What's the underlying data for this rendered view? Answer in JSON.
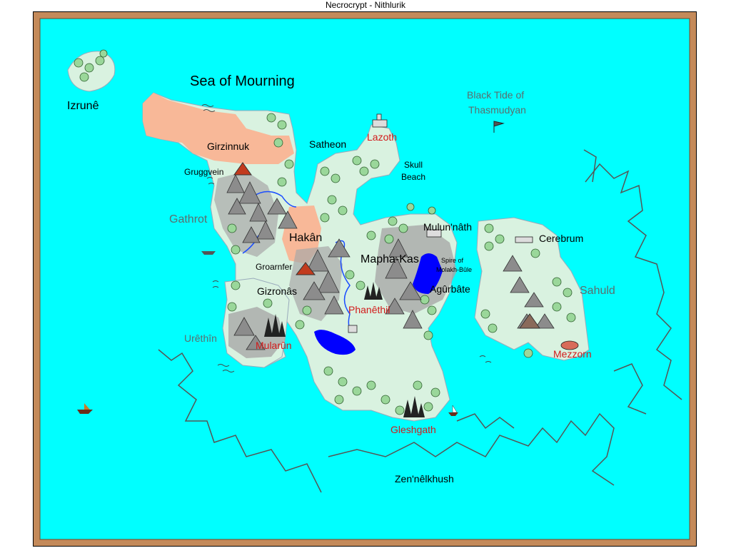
{
  "window": {
    "title": "Necrocrypt - Nithlurik"
  },
  "colors": {
    "sea": "#00ffff",
    "land": "#d9f2e0",
    "desert": "#f8b898",
    "mountain_shade": "#a8a8a8",
    "lake": "#0000ff",
    "frame": "#c48a5a",
    "red_label": "#d21a1a",
    "grey_label": "#5a6e6e"
  },
  "labels": {
    "sea_of_mourning": "Sea of Mourning",
    "izrune": "Izrunê",
    "black_tide": "Black Tide of",
    "black_tide_2": "Thasmudyan",
    "lazoth": "Lazoth",
    "satheon": "Satheon",
    "skull_beach_1": "Skull",
    "skull_beach_2": "Beach",
    "girzinnuk": "Girzinnuk",
    "gruggvein": "Gruggvein",
    "gathrot": "Gathrot",
    "hakan": "Hakân",
    "groarnfer": "Groarnfer",
    "mulun_nath": "Mulun'nâth",
    "mapha_kas": "Mapha-Kas",
    "spire_1": "Spire of",
    "spire_2": "Molakh-Bûle",
    "agurbate": "Agûrbâte",
    "cerebrum": "Cerebrum",
    "sahuld": "Sahuld",
    "gizronas": "Gizronâs",
    "phanethil": "Phanêthil",
    "urethin": "Urêthîn",
    "mularun": "Mularûn",
    "mezzorn": "Mezzorn",
    "gleshgath": "Gleshgath",
    "zennelkhush": "Zen'nêlkhush"
  },
  "icons": [
    "tree-icon",
    "mountain-icon",
    "volcano-icon",
    "castle-icon",
    "dark-spire-icon",
    "boat-icon",
    "flag-icon",
    "wave-icon",
    "reef-line"
  ]
}
